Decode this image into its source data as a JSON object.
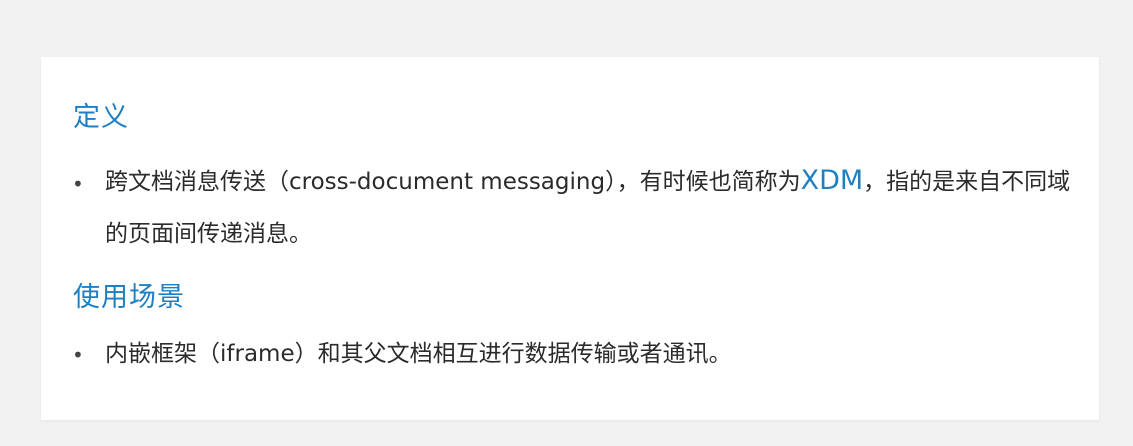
{
  "definition": {
    "heading": "定义",
    "text_before": "跨文档消息传送（cross-document messaging），有时候也简称为",
    "highlight": "XDM",
    "text_after": "，指的是来自不同域的页面间传递消息。"
  },
  "usage": {
    "heading": "使用场景",
    "text": "内嵌框架（iframe）和其父文档相互进行数据传输或者通讯。"
  },
  "bullet_symbol": "•",
  "colors": {
    "accent": "#1e7fc2",
    "text": "#2b2b2b",
    "background": "#f2f2f2",
    "card": "#ffffff"
  }
}
